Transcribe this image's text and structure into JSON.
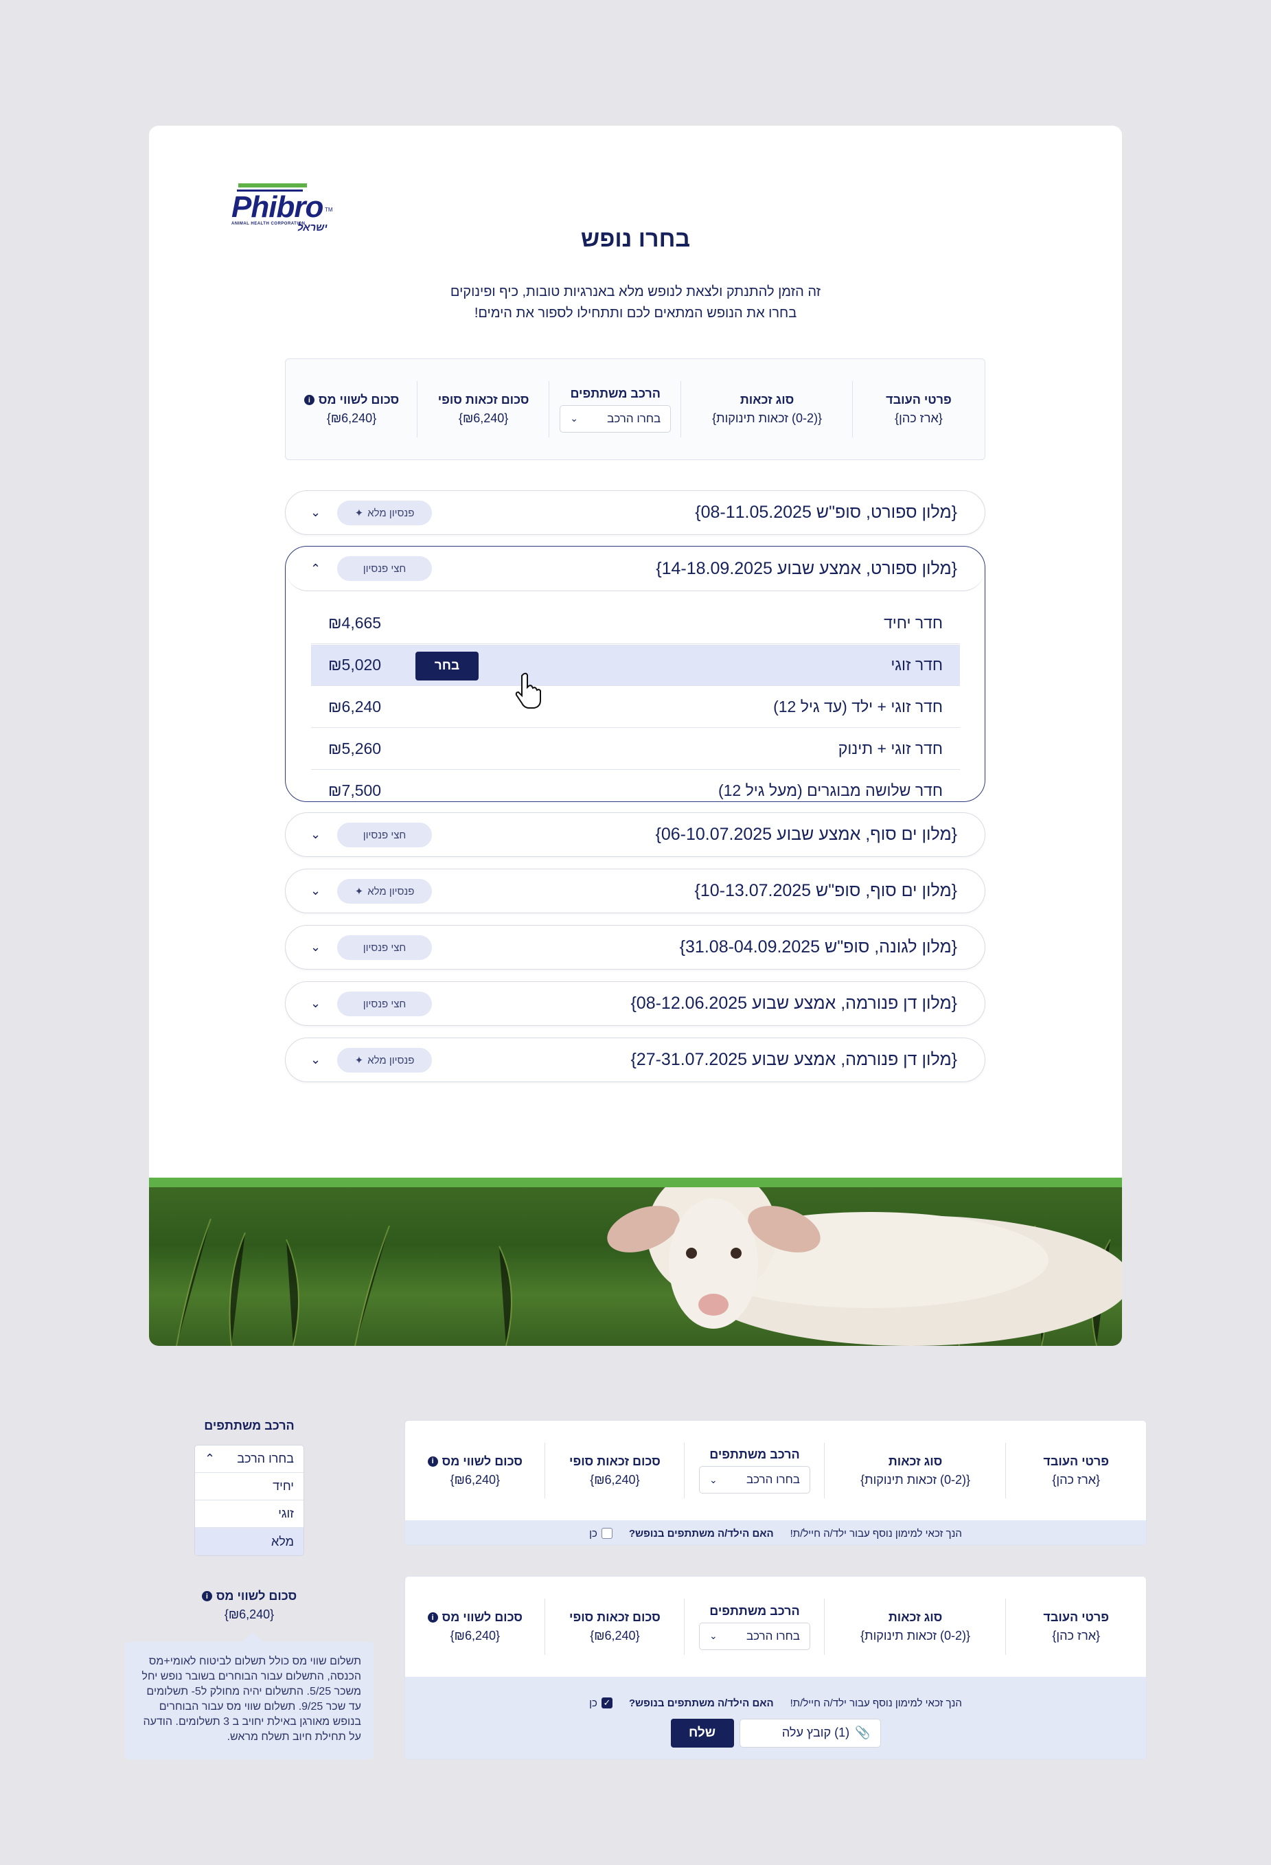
{
  "brand": {
    "name": "Phibro",
    "tagline": "ANIMAL HEALTH CORPORATION",
    "tm": "TM",
    "region": "ישראל",
    "green": "#5fb046",
    "navy": "#1a237e"
  },
  "page": {
    "title": "בחרו נופש",
    "intro_line1": "זה הזמן להתנתק ולצאת לנופש מלא באנרגיות טובות, כיף ופינוקים",
    "intro_line2": "בחרו את הנופש המתאים לכם ותתחילו לספור את הימים!"
  },
  "summary": {
    "employee_head": "פרטי העובד",
    "employee_val": "{ארז כהן}",
    "type_head": "סוג זכאות",
    "type_val": "{(0-2) זכאות תינוקות}",
    "comp_head": "הרכב משתתפים",
    "comp_select": "בחרו הרכב",
    "final_head": "סכום זכאות סופי",
    "final_val": "{₪6,240}",
    "tax_head": "סכום לשווי מס",
    "tax_val": "{₪6,240}",
    "info_icon": "i"
  },
  "vacations": [
    {
      "title": "{מלון ספורט, סופ\"ש 08-11.05.2025}",
      "badge": "פנסיון מלא",
      "star": true
    },
    {
      "title": "{מלון ספורט, אמצע שבוע 14-18.09.2025}",
      "badge": "חצי פנסיון",
      "star": false
    },
    {
      "title": "{מלון ים סוף, אמצע שבוע 06-10.07.2025}",
      "badge": "חצי פנסיון",
      "star": false
    },
    {
      "title": "{מלון ים סוף, סופ\"ש 10-13.07.2025}",
      "badge": "פנסיון מלא",
      "star": true
    },
    {
      "title": "{מלון לגונה, סופ\"ש 31.08-04.09.2025}",
      "badge": "חצי פנסיון",
      "star": false
    },
    {
      "title": "{מלון דן פנורמה, אמצע שבוע 08-12.06.2025}",
      "badge": "חצי פנסיון",
      "star": false
    },
    {
      "title": "{מלון דן פנורמה, אמצע שבוע 27-31.07.2025}",
      "badge": "פנסיון מלא",
      "star": true
    }
  ],
  "rooms": [
    {
      "name": "חדר יחיד",
      "price": "₪4,665"
    },
    {
      "name": "חדר זוגי",
      "price": "₪5,020"
    },
    {
      "name": "חדר זוגי + ילד (עד גיל 12)",
      "price": "₪6,240"
    },
    {
      "name": "חדר זוגי + תינוק",
      "price": "₪5,260"
    },
    {
      "name": "חדר שלושה מבוגרים (מעל גיל 12)",
      "price": "₪7,500"
    }
  ],
  "choose_label": "בחר",
  "dropdown": {
    "head": "הרכב משתתפים",
    "selected": "בחרו הרכב",
    "options": [
      "יחיד",
      "זוגי",
      "מלא"
    ]
  },
  "tooltip": {
    "head": "סכום לשווי מס",
    "val": "{₪6,240}",
    "text": "תשלום שווי מס כולל תשלום לביטוח לאומי+מס הכנסה, התשלום עבור הבוחרים בשובר נופש יחל משכר 5/25. התשלום יהיה מחולק ל5- תשלומים עד שכר 9/25. תשלום שווי מס עבור הבוחרים בנופש מאורגן באילת יחויב ב 3 תשלומים. הודעה על תחילת חיוב תשלח מראש."
  },
  "strip": {
    "note": "הנך זכאי למימון נוסף עבור ילד/ה חייל/ת!",
    "question": "האם הילד/ה משתתפים בנופש?",
    "yes": "כן",
    "upload": "(1) קובץ עלה",
    "send": "שלח"
  }
}
